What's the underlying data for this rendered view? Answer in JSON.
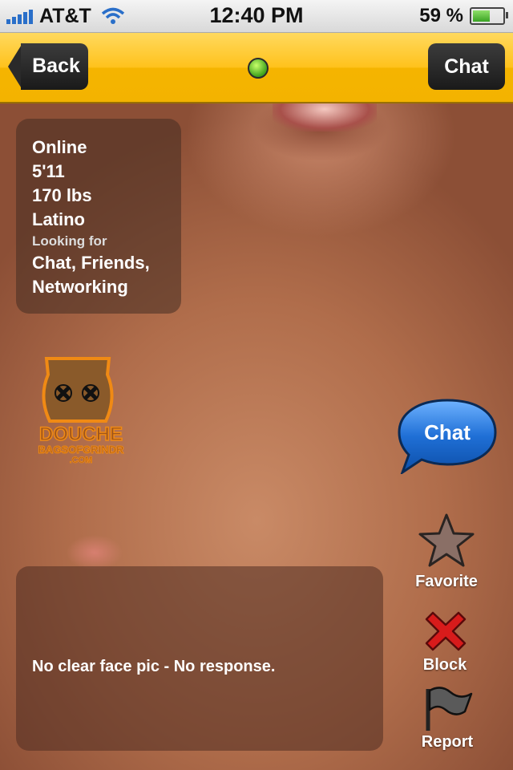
{
  "status_bar": {
    "carrier": "AT&T",
    "time": "12:40 PM",
    "battery_percent": "59 %",
    "battery_level": 0.59,
    "icons": [
      "signal-bars-icon",
      "wifi-icon",
      "battery-icon"
    ]
  },
  "nav": {
    "back_label": "Back",
    "chat_label": "Chat",
    "online_indicator_color": "#3ea21b"
  },
  "profile": {
    "status": "Online",
    "height": "5'11",
    "weight": "170 lbs",
    "ethnicity": "Latino",
    "looking_for_label": "Looking for",
    "looking_for_line1": "Chat, Friends,",
    "looking_for_line2": "Networking"
  },
  "watermark": {
    "line1": "DOUCHE",
    "line2": "BAGSOFGRINDR",
    "line3": ".COM"
  },
  "actions": {
    "chat_bubble_label": "Chat",
    "favorite_label": "Favorite",
    "block_label": "Block",
    "report_label": "Report"
  },
  "note": {
    "text": "No clear face pic - No response."
  },
  "colors": {
    "nav_accent": "#ffc21c",
    "chat_bubble": "#1f6fd6",
    "block_red": "#d81b1b"
  }
}
